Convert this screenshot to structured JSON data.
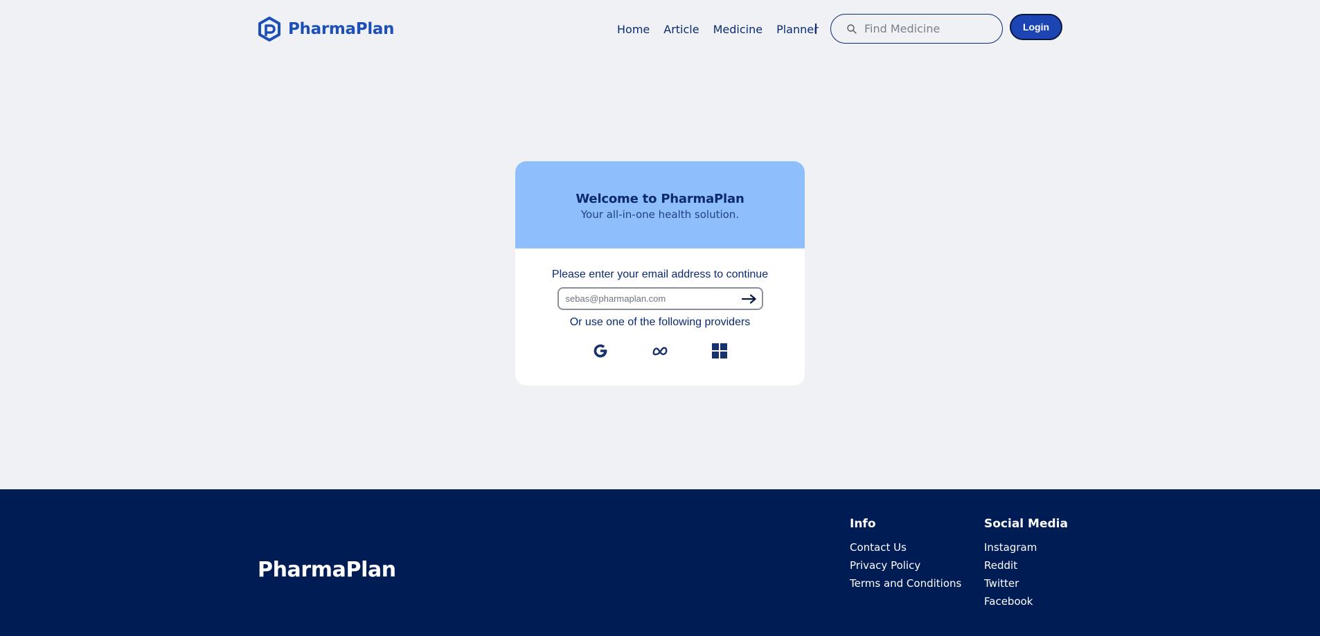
{
  "header": {
    "brand_name": "PharmaPlan",
    "nav": [
      "Home",
      "Article",
      "Medicine",
      "Planner"
    ],
    "search_placeholder": "Find Medicine",
    "login_label": "Login"
  },
  "card": {
    "title": "Welcome to PharmaPlan",
    "subtitle": "Your all-in-one health solution.",
    "prompt": "Please enter your email address to continue",
    "email_placeholder": "sebas@pharmaplan.com",
    "alt_text": "Or use one of the following providers",
    "providers": [
      "google-icon",
      "meta-icon",
      "microsoft-icon"
    ]
  },
  "footer": {
    "brand_name": "PharmaPlan",
    "info": {
      "heading": "Info",
      "links": [
        "Contact Us",
        "Privacy Policy",
        "Terms and Conditions"
      ]
    },
    "social": {
      "heading": "Social Media",
      "links": [
        "Instagram",
        "Reddit",
        "Twitter",
        "Facebook"
      ]
    }
  },
  "colors": {
    "brand_blue": "#1d4fb8",
    "navy": "#0b2a6f",
    "footer_bg": "#001c55",
    "card_header": "#8fbefc",
    "page_bg": "#eff1f5"
  }
}
